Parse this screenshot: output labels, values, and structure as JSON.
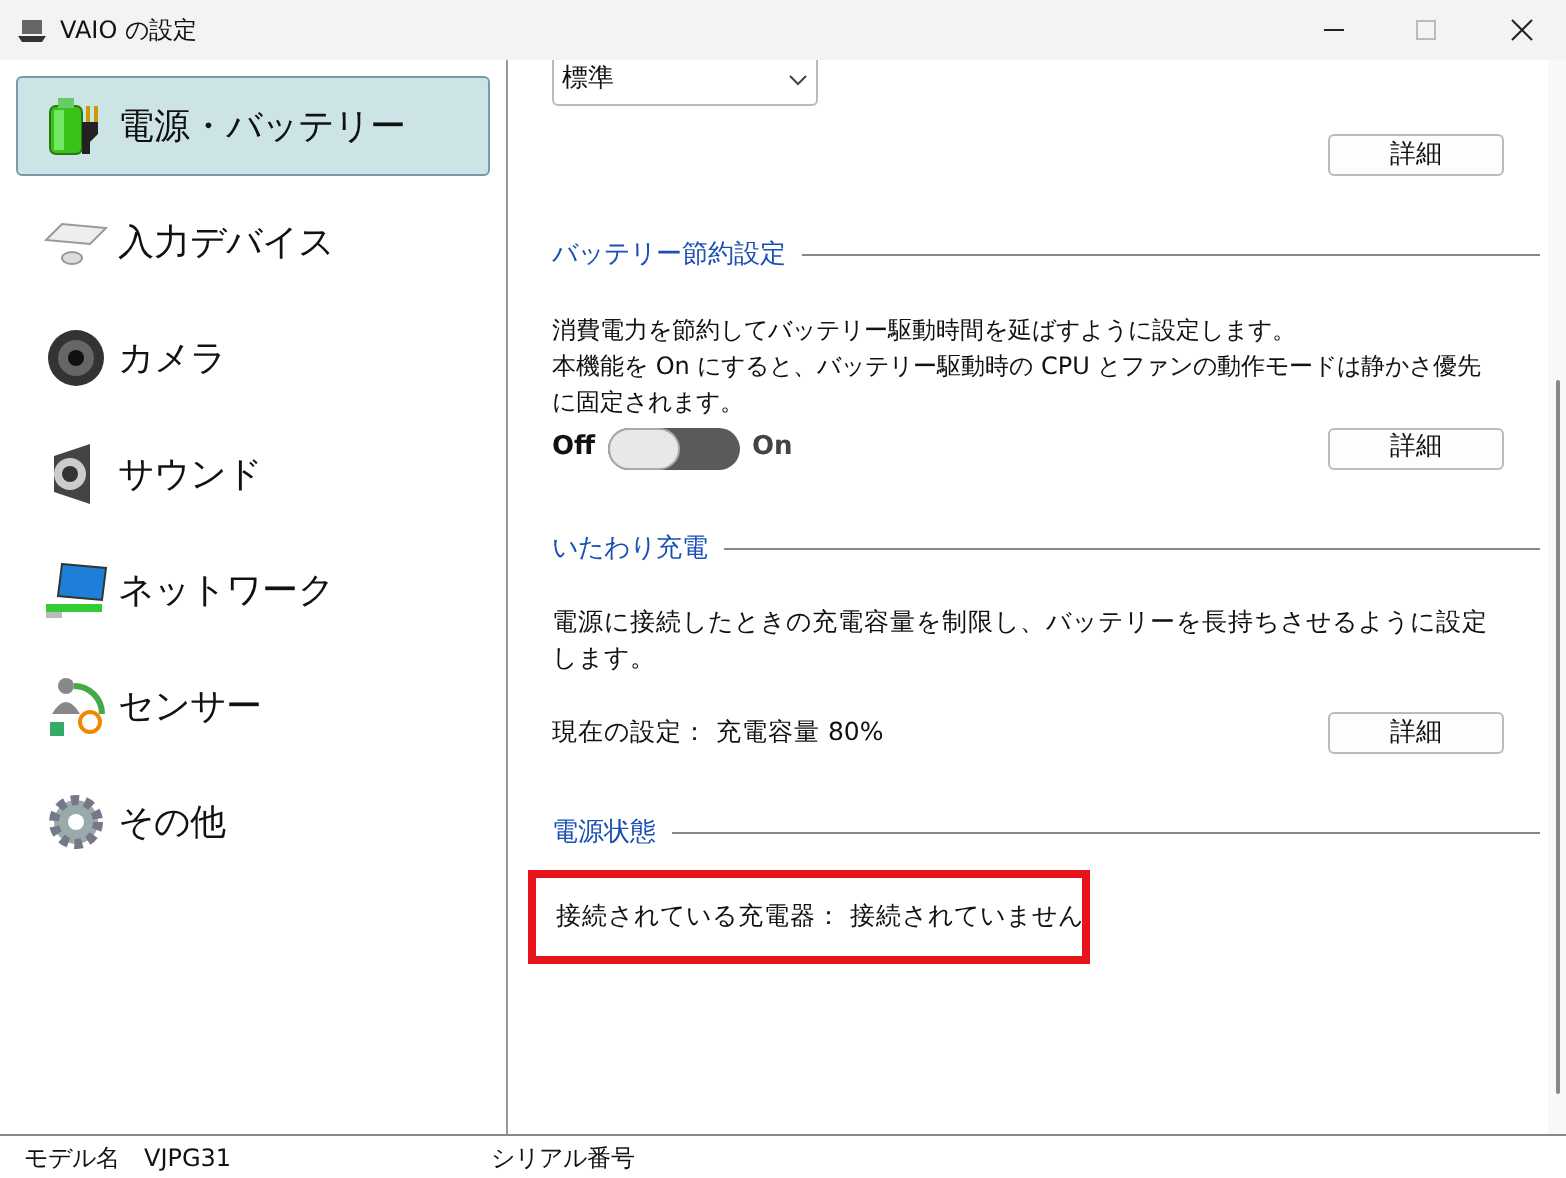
{
  "window": {
    "title": "VAIO の設定"
  },
  "sidebar": {
    "items": [
      {
        "label": "電源・バッテリー",
        "kind": "battery",
        "selected": true
      },
      {
        "label": "入力デバイス",
        "kind": "keyboard",
        "selected": false
      },
      {
        "label": "カメラ",
        "kind": "camera",
        "selected": false
      },
      {
        "label": "サウンド",
        "kind": "speaker",
        "selected": false
      },
      {
        "label": "ネットワーク",
        "kind": "network",
        "selected": false
      },
      {
        "label": "センサー",
        "kind": "sensor",
        "selected": false
      },
      {
        "label": "その他",
        "kind": "gear",
        "selected": false
      }
    ]
  },
  "content": {
    "mode_dropdown": {
      "value": "標準"
    },
    "detail_button": "詳細",
    "sections": [
      {
        "title": "バッテリー節約設定",
        "description": [
          "消費電力を節約してバッテリー駆動時間を延ばすように設定します。",
          "本機能を On にすると、バッテリー駆動時の CPU とファンの動作モードは静かさ優先に固定されます。"
        ],
        "toggle": {
          "off_label": "Off",
          "on_label": "On",
          "on": false
        },
        "button": "詳細"
      },
      {
        "title": "いたわり充電",
        "description": [
          "電源に接続したときの充電容量を制限し、バッテリーを長持ちさせるように設定します。"
        ],
        "current_setting": "現在の設定： 充電容量 80%",
        "button": "詳細"
      },
      {
        "title": "電源状態",
        "status": "接続されている充電器： 接続されていません",
        "highlighted": true
      }
    ]
  },
  "status_bar": {
    "model_label": "モデル名",
    "model_value": "VJPG31",
    "serial_label": "シリアル番号"
  }
}
